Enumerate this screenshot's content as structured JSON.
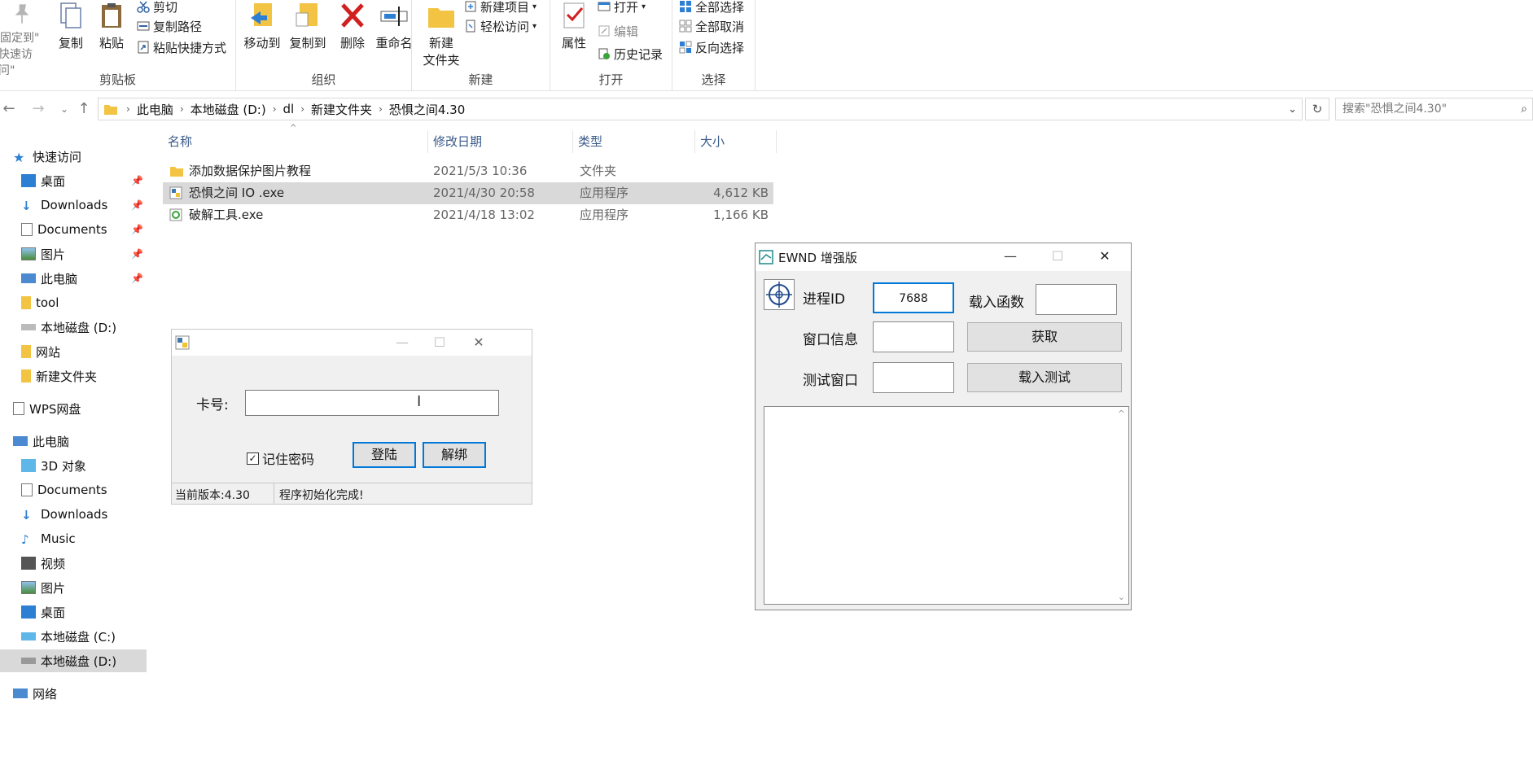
{
  "ribbon": {
    "pin_label_1": "固定到\"",
    "pin_label_2": "快速访问\"",
    "copy": "复制",
    "paste": "粘贴",
    "cut": "剪切",
    "copy_path": "复制路径",
    "paste_shortcut": "粘贴快捷方式",
    "clipboard_group": "剪贴板",
    "move_to": "移动到",
    "copy_to": "复制到",
    "delete": "删除",
    "rename": "重命名",
    "organize_group": "组织",
    "new_folder_1": "新建",
    "new_folder_2": "文件夹",
    "new_item": "新建项目",
    "easy_access": "轻松访问",
    "new_group": "新建",
    "properties": "属性",
    "open": "打开",
    "edit": "编辑",
    "history": "历史记录",
    "open_group": "打开",
    "select_all": "全部选择",
    "select_none": "全部取消",
    "invert_selection": "反向选择",
    "select_group": "选择"
  },
  "address": {
    "crumbs": [
      "此电脑",
      "本地磁盘 (D:)",
      "dl",
      "新建文件夹",
      "恐惧之间4.30"
    ],
    "search_placeholder": "搜索\"恐惧之间4.30\""
  },
  "nav": {
    "quick_access": "快速访问",
    "items": [
      "桌面",
      "Downloads",
      "Documents",
      "图片",
      "此电脑",
      "tool",
      "本地磁盘 (D:)",
      "网站",
      "新建文件夹"
    ],
    "wps": "WPS网盘",
    "this_pc": "此电脑",
    "pc_items": [
      "3D 对象",
      "Documents",
      "Downloads",
      "Music",
      "视频",
      "图片",
      "桌面",
      "本地磁盘 (C:)",
      "本地磁盘 (D:)"
    ],
    "network": "网络"
  },
  "files": {
    "columns": [
      "名称",
      "修改日期",
      "类型",
      "大小"
    ],
    "rows": [
      {
        "name": "添加数据保护图片教程",
        "date": "2021/5/3 10:36",
        "type": "文件夹",
        "size": ""
      },
      {
        "name": "恐惧之间 IO .exe",
        "date": "2021/4/30 20:58",
        "type": "应用程序",
        "size": "4,612 KB"
      },
      {
        "name": "破解工具.exe",
        "date": "2021/4/18 13:02",
        "type": "应用程序",
        "size": "1,166 KB"
      }
    ]
  },
  "login_window": {
    "card_label": "卡号:",
    "remember": "记住密码",
    "login_btn": "登陆",
    "unbind_btn": "解绑",
    "version": "当前版本:4.30",
    "status": "程序初始化完成!"
  },
  "ewnd_window": {
    "title": "EWND 增强版",
    "pid_label": "进程ID",
    "pid_value": "7688",
    "load_func_label": "载入函数",
    "window_info_label": "窗口信息",
    "get_btn": "获取",
    "test_window_label": "测试窗口",
    "load_test_btn": "载入测试"
  },
  "colors": {
    "accent": "#0078d7",
    "selection": "#d9d9d9",
    "folder": "#f3c443"
  }
}
